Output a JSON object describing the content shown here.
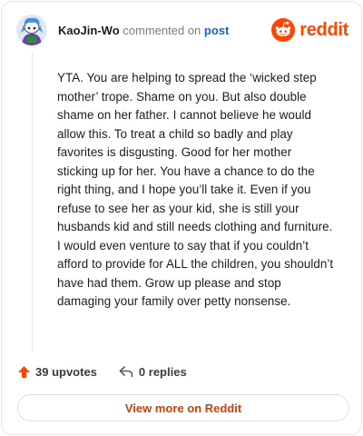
{
  "header": {
    "username": "KaoJin-Wo",
    "verb": "commented on",
    "post_link": "post",
    "brand": "reddit",
    "avatar_icon": "snoo-avatar-icon",
    "logo_icon": "reddit-logo-icon"
  },
  "comment": {
    "body": "YTA. You are helping to spread the ‘wicked step mother’ trope. Shame on you. But also double shame on her father. I cannot believe he would allow this. To treat a child so badly and play favorites is disgusting. Good for her mother sticking up for her. You have a chance to do the right thing, and I hope you’ll take it. Even if you refuse to see her as your kid, she is still your husbands kid and still needs clothing and furniture. I would even venture to say that if you couldn’t afford to provide for ALL the children, you shouldn’t have had them. Grow up please and stop damaging your family over petty nonsense."
  },
  "actions": {
    "upvotes": "39 upvotes",
    "replies": "0 replies",
    "upvote_icon": "upvote-arrow-icon",
    "reply_icon": "reply-arrow-icon"
  },
  "footer": {
    "view_more": "View more on Reddit"
  },
  "colors": {
    "brand": "#ff4500",
    "link": "#1a5fd0",
    "button_text": "#d93a00"
  }
}
